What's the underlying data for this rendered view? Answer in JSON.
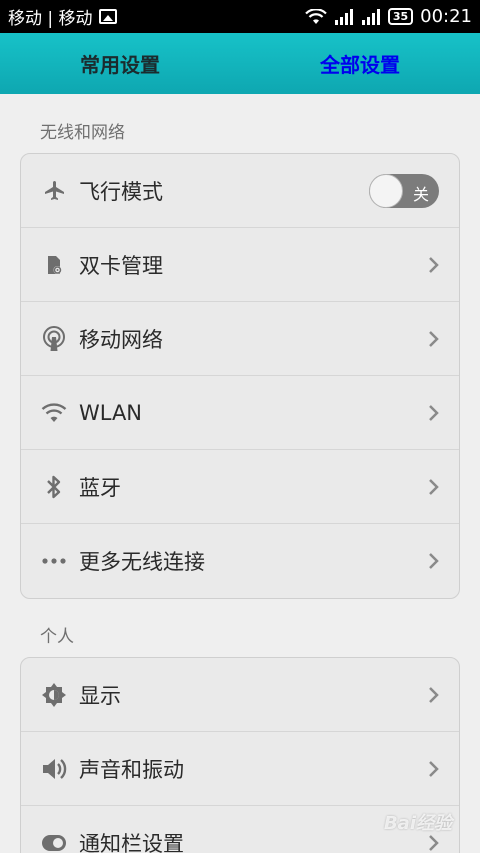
{
  "status_bar": {
    "carriers": "移动 | 移动",
    "battery": "35",
    "time": "00:21"
  },
  "tabs": [
    {
      "label": "常用设置",
      "active": false
    },
    {
      "label": "全部设置",
      "active": true
    }
  ],
  "sections": [
    {
      "title": "无线和网络",
      "items": [
        {
          "label": "飞行模式",
          "icon": "airplane-icon",
          "toggle": "关"
        },
        {
          "label": "双卡管理",
          "icon": "sim-card-icon"
        },
        {
          "label": "移动网络",
          "icon": "mobile-network-icon"
        },
        {
          "label": "WLAN",
          "icon": "wifi-icon"
        },
        {
          "label": "蓝牙",
          "icon": "bluetooth-icon"
        },
        {
          "label": "更多无线连接",
          "icon": "more-icon"
        }
      ]
    },
    {
      "title": "个人",
      "items": [
        {
          "label": "显示",
          "icon": "brightness-icon"
        },
        {
          "label": "声音和振动",
          "icon": "sound-icon"
        },
        {
          "label": "通知栏设置",
          "icon": "notification-toggle-icon"
        }
      ]
    }
  ],
  "watermark": "Bai经验",
  "colors": {
    "header_gradient_top": "#17c2c8",
    "header_gradient_bottom": "#0ea7b1",
    "active_tab": "#0000ee",
    "background": "#efefef"
  }
}
